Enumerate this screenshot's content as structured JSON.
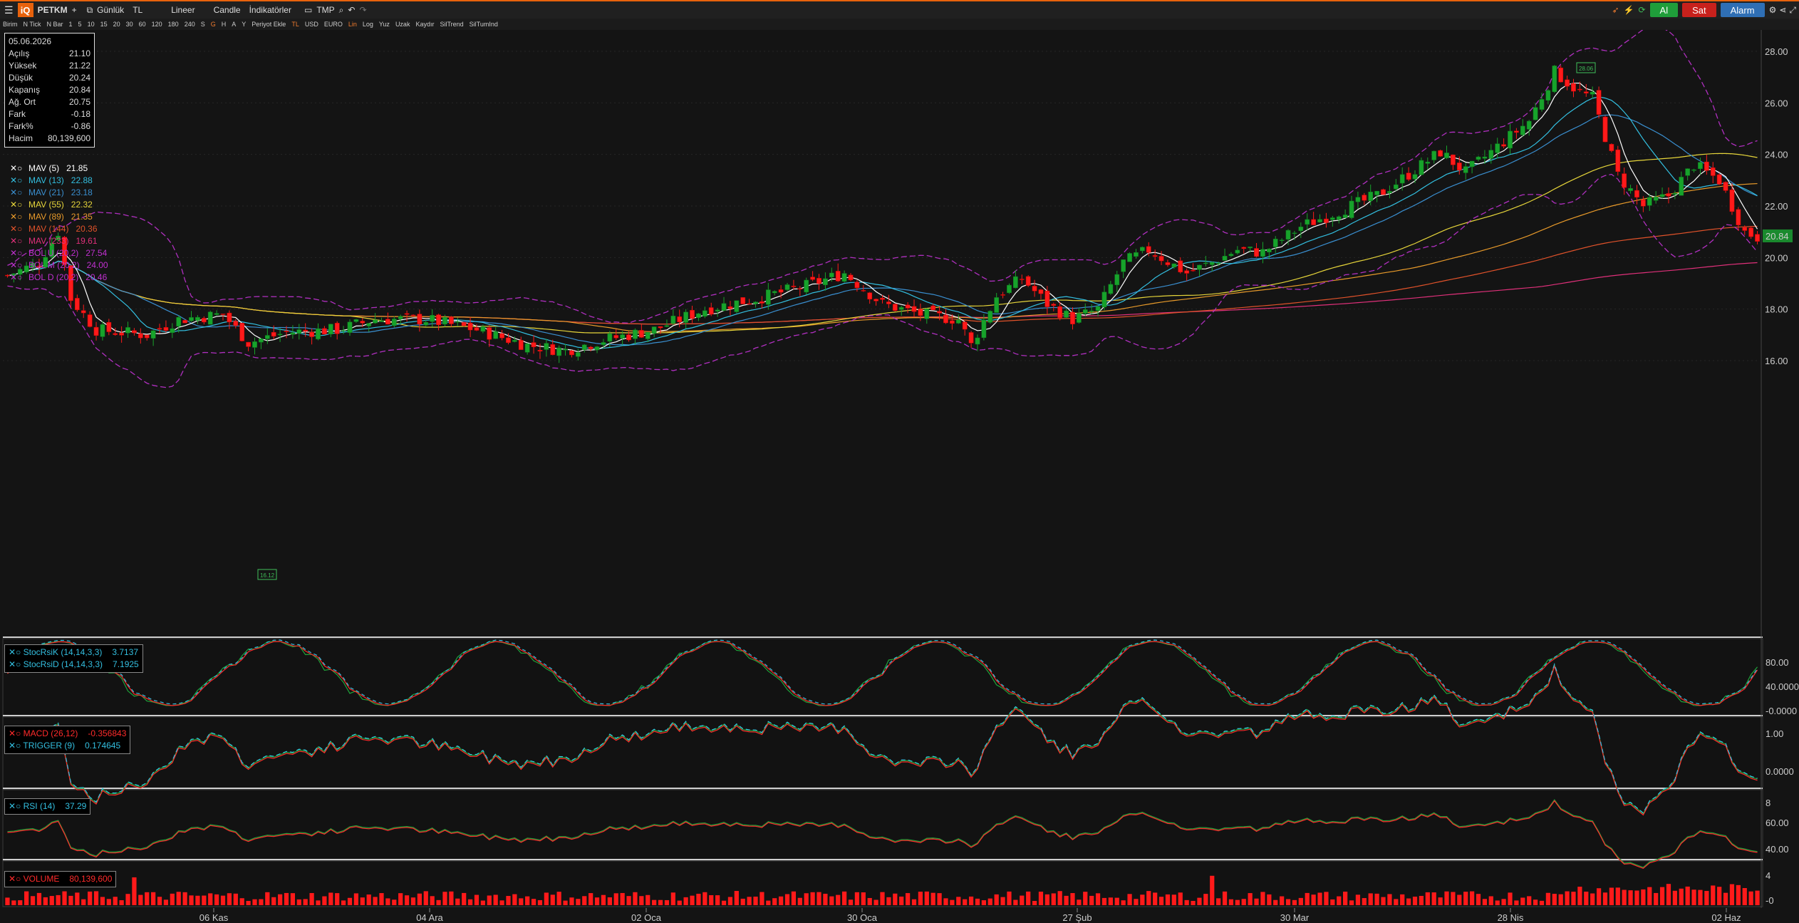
{
  "toolbar": {
    "logo": "iQ",
    "symbol": "PETKM",
    "plus": "+",
    "period": "Günlük",
    "currency": "TL",
    "scale": "Lineer",
    "chart_type": "Candle",
    "indicators": "İndikatörler",
    "template": "TMP",
    "buy": "Al",
    "sell": "Sat",
    "alarm": "Alarm"
  },
  "subbar": [
    "Birim",
    "N Tick",
    "N Bar",
    "1",
    "5",
    "10",
    "15",
    "20",
    "30",
    "60",
    "120",
    "180",
    "240",
    "S",
    "G",
    "H",
    "A",
    "Y",
    "Periyot Ekle",
    "TL",
    "USD",
    "EURO",
    "Lin",
    "Log",
    "Yuz",
    "Uzak",
    "Kaydır",
    "SilTrend",
    "SilTumInd"
  ],
  "subbar_hot": [
    "G",
    "TL",
    "Lin"
  ],
  "info": {
    "date": "05.06.2026",
    "rows": [
      {
        "k": "Açılış",
        "v": "21.10"
      },
      {
        "k": "Yüksek",
        "v": "21.22"
      },
      {
        "k": "Düşük",
        "v": "20.24"
      },
      {
        "k": "Kapanış",
        "v": "20.84"
      },
      {
        "k": "Ağ. Ort",
        "v": "20.75"
      },
      {
        "k": "Fark",
        "v": "-0.18"
      },
      {
        "k": "Fark%",
        "v": "-0.86"
      },
      {
        "k": "Hacim",
        "v": "80,139,600"
      }
    ]
  },
  "legend": [
    {
      "name": "MAV (5)",
      "value": "21.85",
      "color": "#ffffff"
    },
    {
      "name": "MAV (13)",
      "value": "22.88",
      "color": "#33bfe0"
    },
    {
      "name": "MAV (21)",
      "value": "23.18",
      "color": "#3a8fd0"
    },
    {
      "name": "MAV (55)",
      "value": "22.32",
      "color": "#e6d53a"
    },
    {
      "name": "MAV (89)",
      "value": "21.35",
      "color": "#e89a2a"
    },
    {
      "name": "MAV (144)",
      "value": "20.36",
      "color": "#e0522a"
    },
    {
      "name": "MAV (233)",
      "value": "19.61",
      "color": "#e0307a"
    },
    {
      "name": "BOL U (20,2)",
      "value": "27.54",
      "color": "#c030d0"
    },
    {
      "name": "BOL M (20,2)",
      "value": "24.00",
      "color": "#c030d0"
    },
    {
      "name": "BOL D (20,2)",
      "value": "20.46",
      "color": "#c030d0"
    }
  ],
  "price_axis": {
    "ticks": [
      "28.00",
      "26.00",
      "24.00",
      "22.00",
      "20.00",
      "18.00",
      "16.00"
    ],
    "last": "20.84",
    "high_marker": "28.06",
    "low_marker": "16.12"
  },
  "x_axis": [
    "06 Kas",
    "04 Ara",
    "02 Oca",
    "30 Oca",
    "27 Şub",
    "30 Mar",
    "28 Nis",
    "02 Haz"
  ],
  "panels": {
    "stoch": {
      "legend": [
        {
          "name": "StocRsiK (14,14,3,3)",
          "value": "3.7137"
        },
        {
          "name": "StocRsiD (14,14,3,3)",
          "value": "7.1925"
        }
      ],
      "ticks": [
        "80.00",
        "40.0000",
        "-0.0000"
      ]
    },
    "macd": {
      "legend": [
        {
          "name": "MACD (26,12)",
          "value": "-0.356843"
        },
        {
          "name": "TRIGGER (9)",
          "value": "0.174645"
        }
      ],
      "ticks": [
        "1.00",
        "0.0000"
      ]
    },
    "rsi": {
      "legend": [
        {
          "name": "RSI (14)",
          "value": "37.29"
        }
      ],
      "ticks": [
        "8",
        "60.00",
        "40.00"
      ]
    },
    "volume": {
      "legend": [
        {
          "name": "VOLUME",
          "value": "80,139,600"
        }
      ],
      "ticks": [
        "4",
        "-0"
      ]
    }
  },
  "colors": {
    "up": "#17a32b",
    "down": "#ff1a1a",
    "accent": "#e8620c",
    "buy": "#1f9e3a",
    "sell": "#c8211c",
    "alarm": "#2f6fb5"
  }
}
